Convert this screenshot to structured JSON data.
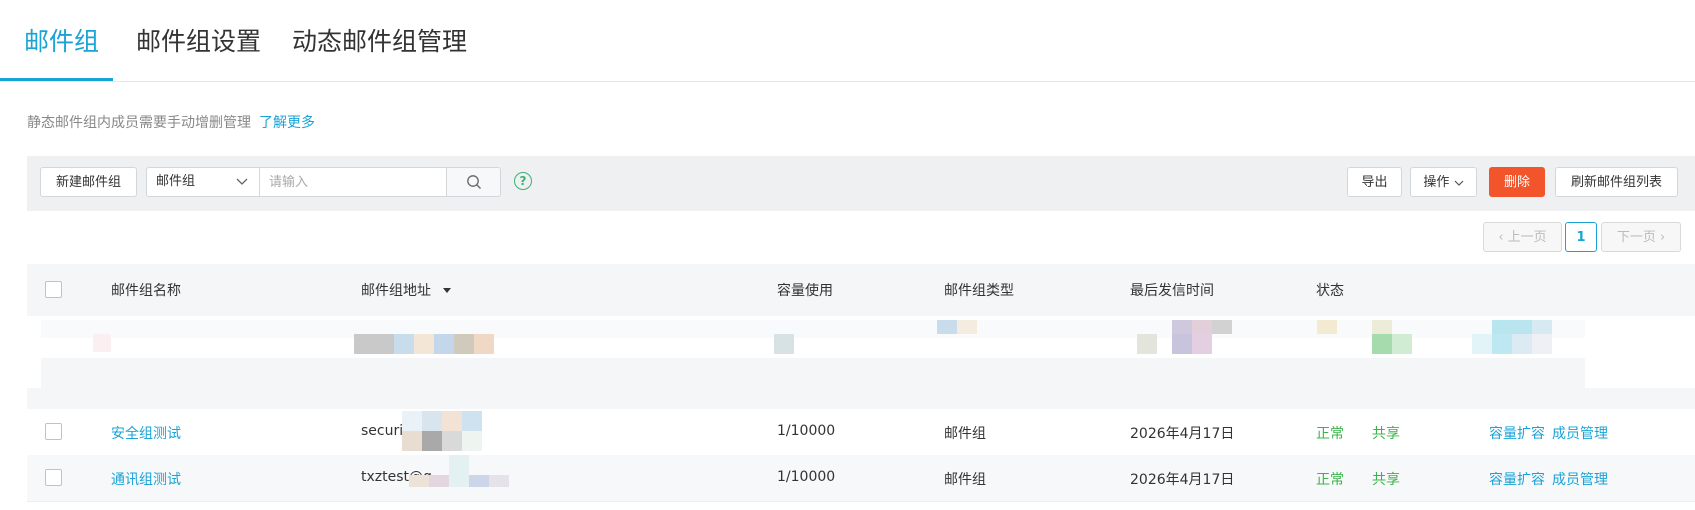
{
  "tabs": [
    "邮件组",
    "邮件组设置",
    "动态邮件组管理"
  ],
  "notice": {
    "text": "静态邮件组内成员需要手动增删管理",
    "link": "了解更多"
  },
  "toolbar": {
    "new_group": "新建邮件组",
    "filter_selected": "邮件组",
    "search_placeholder": "请输入",
    "export": "导出",
    "operations": "操作",
    "delete": "删除",
    "refresh": "刷新邮件组列表"
  },
  "pager": {
    "prev": "上一页",
    "current": "1",
    "next": "下一页"
  },
  "table": {
    "headers": [
      "邮件组名称",
      "邮件组地址",
      "容量使用",
      "邮件组类型",
      "最后发信时间",
      "状态"
    ],
    "rows": [
      {
        "name": "安全组测试",
        "address": "security@",
        "capacity": "1/10000",
        "type": "邮件组",
        "last_sent": "2026年4月17日",
        "status": "正常",
        "share": "共享",
        "action1": "容量扩容",
        "action2": "成员管理"
      },
      {
        "name": "通讯组测试",
        "address": "txztest@q",
        "capacity": "1/10000",
        "type": "邮件组",
        "last_sent": "2026年4月17日",
        "status": "正常",
        "share": "共享",
        "action1": "容量扩容",
        "action2": "成员管理"
      }
    ]
  },
  "colors": {
    "accent": "#1aa3d6",
    "danger": "#f2552c",
    "success": "#3bb44a"
  },
  "icons": [
    "search-icon",
    "help-icon",
    "chevron-down-icon",
    "sort-desc-icon"
  ]
}
